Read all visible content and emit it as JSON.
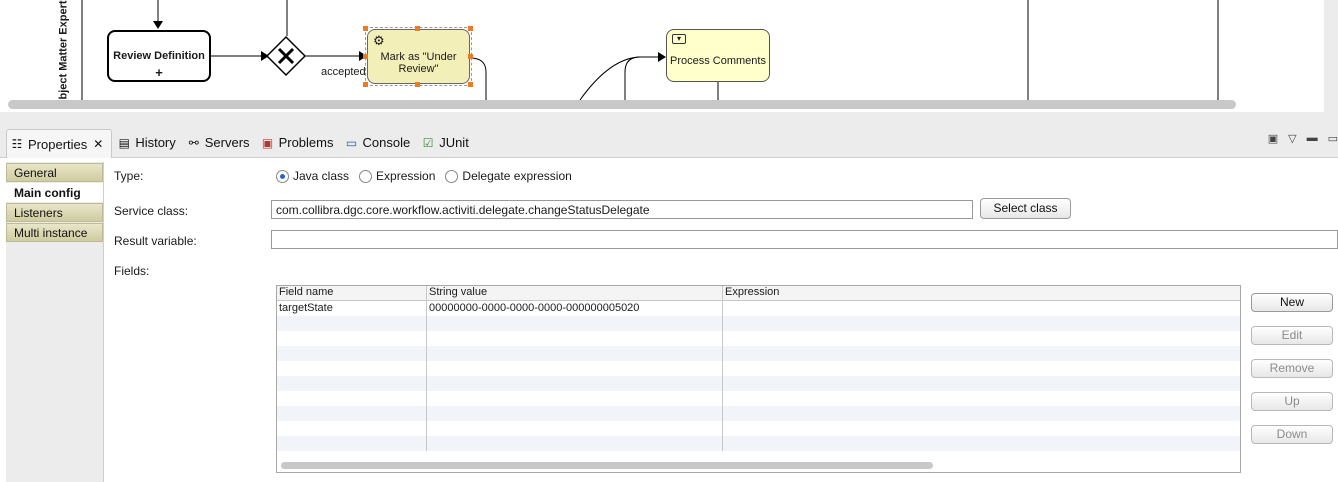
{
  "diagram": {
    "lane_label": "bject Matter Expert",
    "tasks": {
      "review_definition": "Review Definition",
      "review_definition_marker": "+",
      "mark_under_review": "Mark as \"Under Review\"",
      "process_comments": "Process Comments"
    },
    "flow_label_accepted": "accepted",
    "icons": {
      "service_task": "gear-icon",
      "receive_task": "envelope-icon",
      "gateway": "exclusive-gateway-icon"
    }
  },
  "tabs": [
    {
      "label": "Properties",
      "icon": "properties-icon",
      "active": true
    },
    {
      "label": "History",
      "icon": "history-icon"
    },
    {
      "label": "Servers",
      "icon": "servers-icon"
    },
    {
      "label": "Problems",
      "icon": "problems-icon"
    },
    {
      "label": "Console",
      "icon": "console-icon"
    },
    {
      "label": "JUnit",
      "icon": "junit-icon"
    }
  ],
  "view_actions": [
    "new-window-icon",
    "view-menu-icon",
    "minimize-icon",
    "maximize-icon"
  ],
  "nav": {
    "items": [
      "General",
      "Main config",
      "Listeners",
      "Multi instance"
    ],
    "selected": "Main config"
  },
  "form": {
    "type_label": "Type:",
    "type_options": [
      "Java class",
      "Expression",
      "Delegate expression"
    ],
    "type_selected": "Java class",
    "service_class_label": "Service class:",
    "service_class_value": "com.collibra.dgc.core.workflow.activiti.delegate.changeStatusDelegate",
    "select_class_button": "Select class",
    "result_variable_label": "Result variable:",
    "result_variable_value": "",
    "fields_label": "Fields:"
  },
  "fields_table": {
    "columns": [
      "Field name",
      "String value",
      "Expression"
    ],
    "rows": [
      {
        "field_name": "targetState",
        "string_value": "00000000-0000-0000-0000-000000005020",
        "expression": ""
      }
    ],
    "buttons": [
      {
        "label": "New",
        "enabled": true
      },
      {
        "label": "Edit",
        "enabled": false
      },
      {
        "label": "Remove",
        "enabled": false
      },
      {
        "label": "Up",
        "enabled": false
      },
      {
        "label": "Down",
        "enabled": false
      }
    ]
  },
  "colors": {
    "task_fill": "#ffffcc",
    "selection_handle": "#f07a1e",
    "nav_item": "#cfcca0",
    "radio_selected": "#2a62c9"
  }
}
